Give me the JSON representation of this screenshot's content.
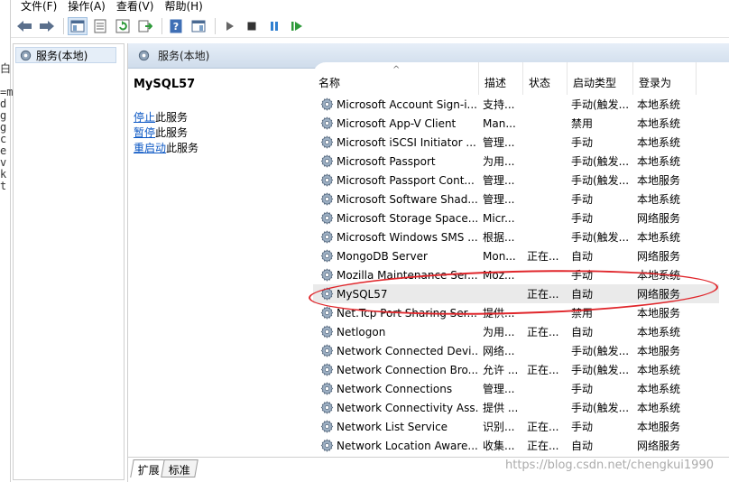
{
  "menu": {
    "file": "文件(F)",
    "action": "操作(A)",
    "view": "查看(V)",
    "help": "帮助(H)"
  },
  "left_edge_text": "白\n\n=m\nd\ng\ng\nc\ne\nv\nk\nt",
  "tree": {
    "item_label": "服务(本地)"
  },
  "header": {
    "title": "服务(本地)"
  },
  "detail": {
    "service_name": "MySQL57",
    "links": [
      {
        "link": "停止",
        "rest": "此服务"
      },
      {
        "link": "暂停",
        "rest": "此服务"
      },
      {
        "link": "重启动",
        "rest": "此服务"
      }
    ]
  },
  "columns": {
    "name": "名称",
    "desc": "描述",
    "status": "状态",
    "startup": "启动类型",
    "logon": "登录为"
  },
  "rows": [
    {
      "name": "Microsoft Account Sign-i...",
      "desc": "支持...",
      "status": "",
      "startup": "手动(触发...",
      "logon": "本地系统"
    },
    {
      "name": "Microsoft App-V Client",
      "desc": "Man...",
      "status": "",
      "startup": "禁用",
      "logon": "本地系统"
    },
    {
      "name": "Microsoft iSCSI Initiator ...",
      "desc": "管理...",
      "status": "",
      "startup": "手动",
      "logon": "本地系统"
    },
    {
      "name": "Microsoft Passport",
      "desc": "为用...",
      "status": "",
      "startup": "手动(触发...",
      "logon": "本地系统"
    },
    {
      "name": "Microsoft Passport Cont...",
      "desc": "管理...",
      "status": "",
      "startup": "手动(触发...",
      "logon": "本地服务"
    },
    {
      "name": "Microsoft Software Shad...",
      "desc": "管理...",
      "status": "",
      "startup": "手动",
      "logon": "本地系统"
    },
    {
      "name": "Microsoft Storage Space...",
      "desc": "Micr...",
      "status": "",
      "startup": "手动",
      "logon": "网络服务"
    },
    {
      "name": "Microsoft Windows SMS ...",
      "desc": "根据...",
      "status": "",
      "startup": "手动(触发...",
      "logon": "本地系统"
    },
    {
      "name": "MongoDB Server",
      "desc": "Mon...",
      "status": "正在...",
      "startup": "自动",
      "logon": "网络服务"
    },
    {
      "name": "Mozilla Maintenance Ser...",
      "desc": "Moz...",
      "status": "",
      "startup": "手动",
      "logon": "本地系统"
    },
    {
      "name": "MySQL57",
      "desc": "",
      "status": "正在...",
      "startup": "自动",
      "logon": "网络服务"
    },
    {
      "name": "Net.Tcp Port Sharing Ser...",
      "desc": "提供...",
      "status": "",
      "startup": "禁用",
      "logon": "本地服务"
    },
    {
      "name": "Netlogon",
      "desc": "为用...",
      "status": "正在...",
      "startup": "自动",
      "logon": "本地系统"
    },
    {
      "name": "Network Connected Devi...",
      "desc": "网络...",
      "status": "",
      "startup": "手动(触发...",
      "logon": "本地服务"
    },
    {
      "name": "Network Connection Bro...",
      "desc": "允许 ...",
      "status": "正在...",
      "startup": "手动(触发...",
      "logon": "本地系统"
    },
    {
      "name": "Network Connections",
      "desc": "管理...",
      "status": "",
      "startup": "手动",
      "logon": "本地系统"
    },
    {
      "name": "Network Connectivity Ass...",
      "desc": "提供 ...",
      "status": "",
      "startup": "手动(触发...",
      "logon": "本地系统"
    },
    {
      "name": "Network List Service",
      "desc": "识别...",
      "status": "正在...",
      "startup": "手动",
      "logon": "本地服务"
    },
    {
      "name": "Network Location Aware...",
      "desc": "收集...",
      "status": "正在...",
      "startup": "自动",
      "logon": "网络服务"
    }
  ],
  "selected_row": 10,
  "tabs": {
    "extended": "扩展",
    "standard": "标准"
  },
  "watermark": "https://blog.csdn.net/chengkui1990",
  "colors": {
    "annotation": "#e0262b",
    "link": "#0b57c4",
    "header_bg": "#dbe5f1"
  }
}
